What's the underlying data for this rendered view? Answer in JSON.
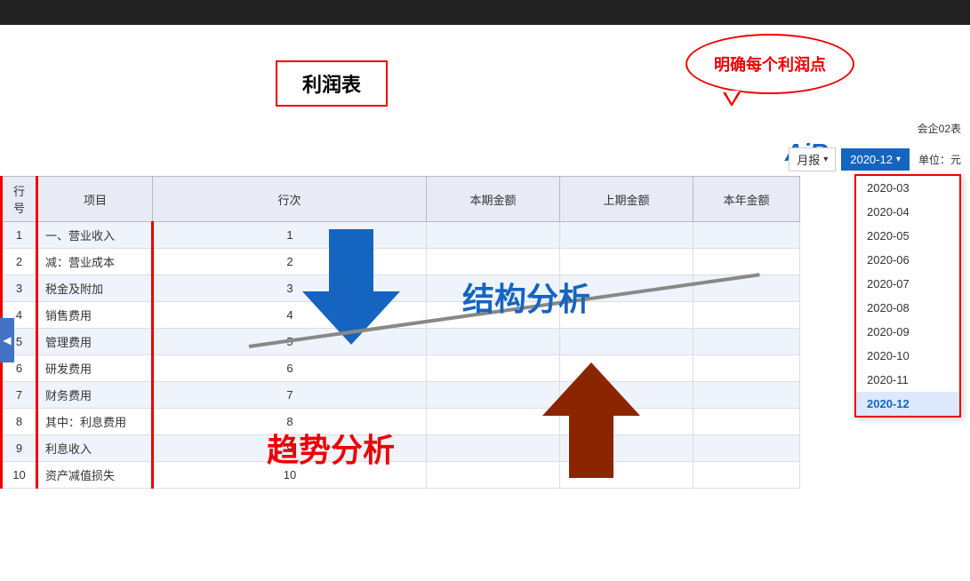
{
  "topbar": {},
  "header": {
    "title": "利润表",
    "bubble_text": "明确每个利润点",
    "air_logo": "AiR",
    "company_label": "会企02表",
    "unit_label": "单位：元"
  },
  "controls": {
    "period_type": "月报",
    "period_value": "2020-12",
    "chevron": "▾"
  },
  "dropdown": {
    "items": [
      "2020-03",
      "2020-04",
      "2020-05",
      "2020-06",
      "2020-07",
      "2020-08",
      "2020-09",
      "2020-10",
      "2020-11",
      "2020-12"
    ],
    "selected": "2020-12"
  },
  "table": {
    "headers": [
      "行号",
      "项目",
      "行次",
      "本期金额",
      "上期金额",
      "本年金额"
    ],
    "rows": [
      {
        "id": 1,
        "item": "一、营业收入",
        "seq": 1
      },
      {
        "id": 2,
        "item": "减：营业成本",
        "seq": 2
      },
      {
        "id": 3,
        "item": "税金及附加",
        "seq": 3
      },
      {
        "id": 4,
        "item": "销售费用",
        "seq": 4
      },
      {
        "id": 5,
        "item": "管理费用",
        "seq": 5
      },
      {
        "id": 6,
        "item": "研发费用",
        "seq": 6
      },
      {
        "id": 7,
        "item": "财务费用",
        "seq": 7
      },
      {
        "id": 8,
        "item": "其中：利息费用",
        "seq": 8
      },
      {
        "id": 9,
        "item": "利息收入",
        "seq": 9
      },
      {
        "id": 10,
        "item": "资产减值损失",
        "seq": 10
      }
    ]
  },
  "annotations": {
    "jiegou": "结构分析",
    "qushi": "趋势分析"
  },
  "collapse_btn_label": "◀"
}
